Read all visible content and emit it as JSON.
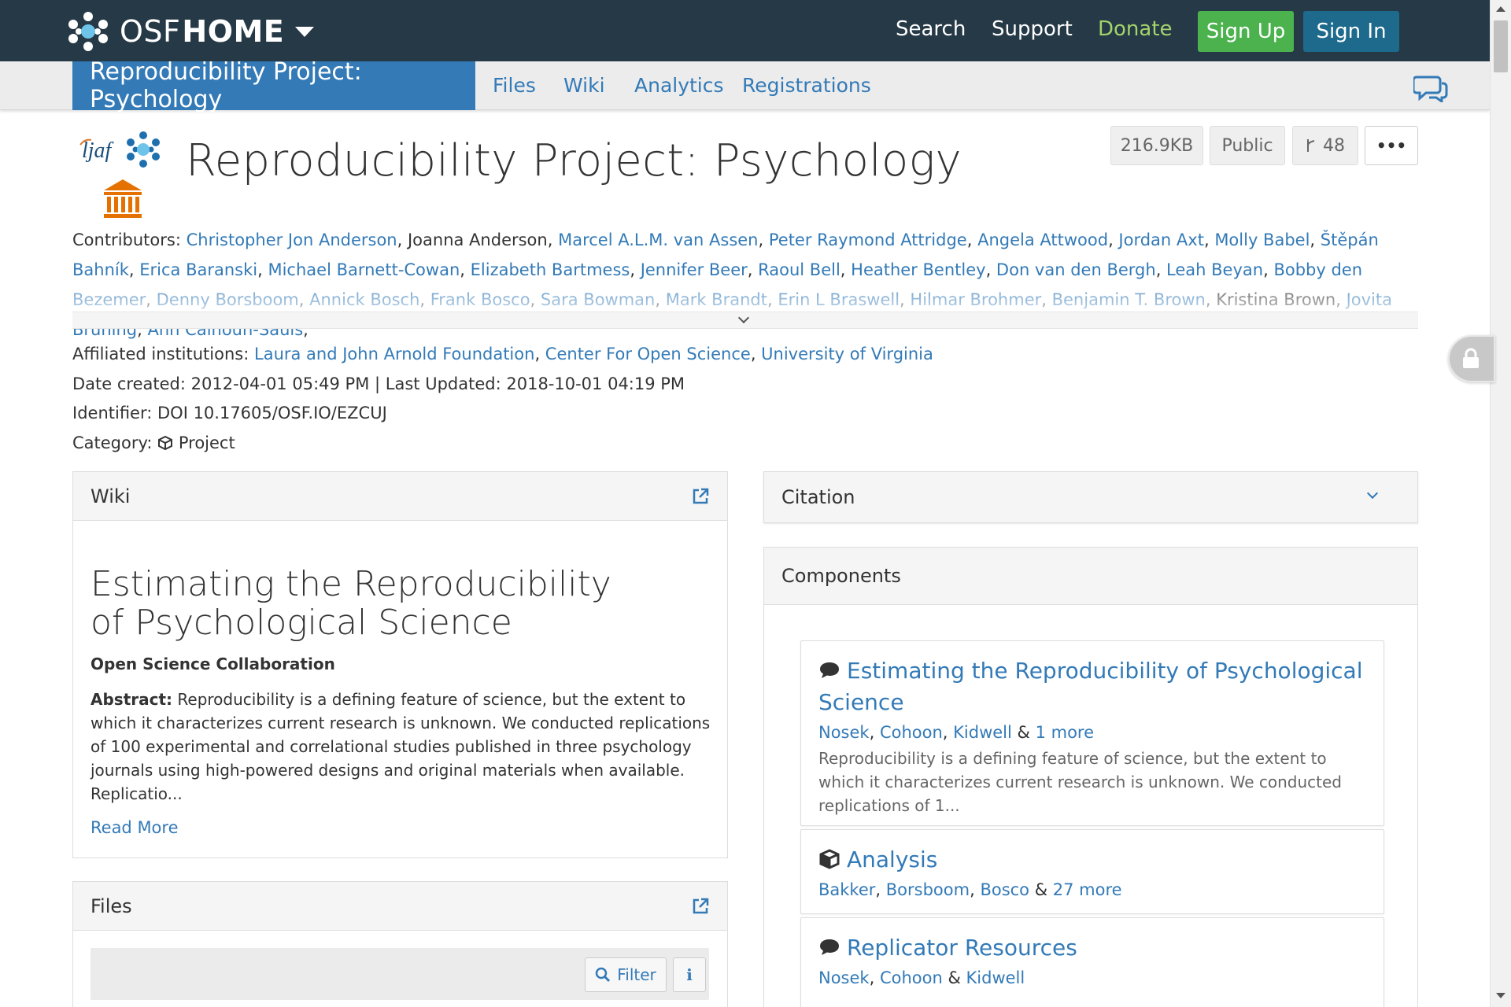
{
  "navbar": {
    "brand_osf": "OSF",
    "brand_home": "HOME",
    "links": {
      "search": "Search",
      "support": "Support",
      "donate": "Donate"
    },
    "signup": "Sign Up",
    "signin": "Sign In",
    "colors": {
      "bar": "#263947",
      "signup": "#4bb24e",
      "signin": "#1d6a8c",
      "donate": "#a3d36b"
    }
  },
  "project_nav": {
    "active": "Reproducibility Project: Psychology",
    "tabs": [
      "Files",
      "Wiki",
      "Analytics",
      "Registrations"
    ]
  },
  "header": {
    "title": "Reproducibility Project: Psychology",
    "size": "216.9KB",
    "visibility": "Public",
    "forks": "48",
    "more": "•••",
    "ljaf_text": "ljaf"
  },
  "contributors": {
    "label": "Contributors:",
    "list": [
      {
        "name": "Christopher Jon Anderson",
        "linked": true
      },
      {
        "name": "Joanna Anderson",
        "linked": false
      },
      {
        "name": "Marcel A.L.M. van Assen",
        "linked": true
      },
      {
        "name": "Peter Raymond Attridge",
        "linked": true
      },
      {
        "name": "Angela Attwood",
        "linked": true
      },
      {
        "name": "Jordan Axt",
        "linked": true
      },
      {
        "name": "Molly Babel",
        "linked": true
      },
      {
        "name": "Štěpán Bahník",
        "linked": true
      },
      {
        "name": "Erica Baranski",
        "linked": true
      },
      {
        "name": "Michael Barnett-Cowan",
        "linked": true
      },
      {
        "name": "Elizabeth Bartmess",
        "linked": true
      },
      {
        "name": "Jennifer Beer",
        "linked": true
      },
      {
        "name": "Raoul Bell",
        "linked": true
      },
      {
        "name": "Heather Bentley",
        "linked": true
      },
      {
        "name": "Don van den Bergh",
        "linked": true
      },
      {
        "name": "Leah Beyan",
        "linked": true
      },
      {
        "name": "Bobby den Bezemer",
        "linked": true
      },
      {
        "name": "Denny Borsboom",
        "linked": true
      },
      {
        "name": "Annick Bosch",
        "linked": true
      },
      {
        "name": "Frank Bosco",
        "linked": true
      },
      {
        "name": "Sara Bowman",
        "linked": true
      },
      {
        "name": "Mark Brandt",
        "linked": true
      },
      {
        "name": "Erin L Braswell",
        "linked": true
      },
      {
        "name": "Hilmar Brohmer",
        "linked": true
      },
      {
        "name": "Benjamin T. Brown",
        "linked": true
      },
      {
        "name": "Kristina Brown",
        "linked": false
      },
      {
        "name": "Jovita Brüning",
        "linked": true
      },
      {
        "name": "Ann Calhoun-Sauls",
        "linked": true
      }
    ]
  },
  "affiliations": {
    "label": "Affiliated institutions:",
    "items": [
      "Laura and John Arnold Foundation",
      "Center For Open Science",
      "University of Virginia"
    ]
  },
  "dates": {
    "created_label": "Date created:",
    "created": "2012-04-01 05:49 PM",
    "separator": "|",
    "updated_label": "Last Updated:",
    "updated": "2018-10-01 04:19 PM"
  },
  "identifier": {
    "label": "Identifier:",
    "value": "DOI 10.17605/OSF.IO/EZCUJ"
  },
  "category": {
    "label": "Category:",
    "value": "Project"
  },
  "wiki": {
    "heading": "Wiki",
    "title": "Estimating the Reproducibility of Psychological Science",
    "author": "Open Science Collaboration",
    "abstract_label": "Abstract:",
    "abstract": " Reproducibility is a defining feature of science, but the extent to which it characterizes current research is unknown. We conducted replications of 100 experimental and correlational studies published in three psychology journals using high-powered designs and original materials when available. Replicatio...",
    "read_more": "Read More"
  },
  "files": {
    "heading": "Files",
    "filter": "Filter",
    "info": "i"
  },
  "citation": {
    "heading": "Citation"
  },
  "components": {
    "heading": "Components",
    "items": [
      {
        "title": "Estimating the Reproducibility of Psychological Science",
        "icon": "comment-icon",
        "authors": [
          "Nosek",
          "Cohoon",
          "Kidwell"
        ],
        "more": "1 more",
        "description": "Reproducibility is a defining feature of science, but the extent to which it characterizes current research is unknown. We conducted replications of 1..."
      },
      {
        "title": "Analysis",
        "icon": "cube-icon",
        "authors": [
          "Bakker",
          "Borsboom",
          "Bosco"
        ],
        "more": "27 more"
      },
      {
        "title": "Replicator Resources",
        "icon": "comment-icon",
        "authors": [
          "Nosek",
          "Cohoon",
          "Kidwell"
        ]
      }
    ]
  }
}
